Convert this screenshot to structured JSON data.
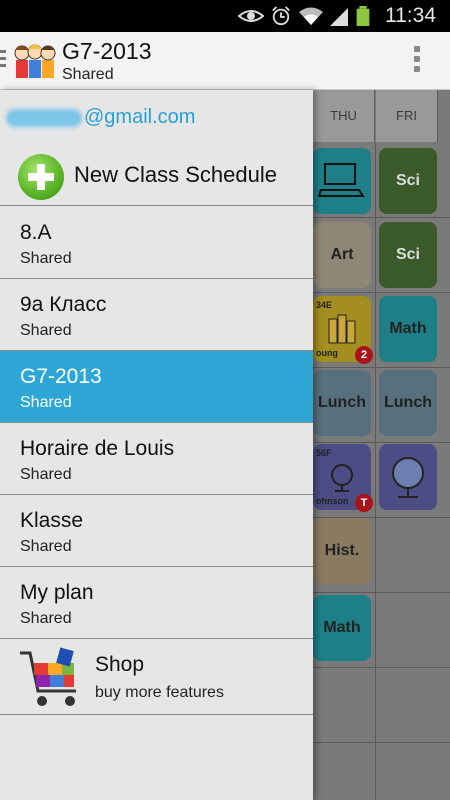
{
  "status_bar": {
    "time": "11:34",
    "icons": [
      "eye-icon",
      "alarm-icon",
      "wifi-icon",
      "signal-icon",
      "battery-icon"
    ]
  },
  "action_bar": {
    "title": "G7-2013",
    "subtitle": "Shared",
    "logo": "kids-logo-icon",
    "menu": "overflow-menu-icon"
  },
  "drawer": {
    "account_suffix": "@gmail.com",
    "new_label": "New Class Schedule",
    "items": [
      {
        "title": "8.A",
        "subtitle": "Shared"
      },
      {
        "title": "9a Класс",
        "subtitle": "Shared"
      },
      {
        "title": "G7-2013",
        "subtitle": "Shared",
        "selected": true
      },
      {
        "title": "Horaire de Louis",
        "subtitle": "Shared"
      },
      {
        "title": "Klasse",
        "subtitle": "Shared"
      },
      {
        "title": "My plan",
        "subtitle": "Shared"
      }
    ],
    "shop": {
      "title": "Shop",
      "subtitle": "buy more features"
    }
  },
  "timetable": {
    "headers": [
      "THU",
      "FRI"
    ],
    "thu": [
      "",
      "Art",
      "",
      "Lunch",
      "",
      "Hist.",
      "Math",
      "",
      ""
    ],
    "fri": [
      "Sci",
      "Sci",
      "Math",
      "Lunch",
      "",
      "",
      "",
      "",
      ""
    ],
    "room_code_1": "34E",
    "teacher_1": "oung",
    "badge_1": "2",
    "room_code_2": "56F",
    "teacher_2": "ohnson",
    "badge_2": "T"
  },
  "colors": {
    "accent": "#2ea7d6",
    "account_text": "#2a9fd6",
    "drawer_bg": "#e6e6e6"
  }
}
